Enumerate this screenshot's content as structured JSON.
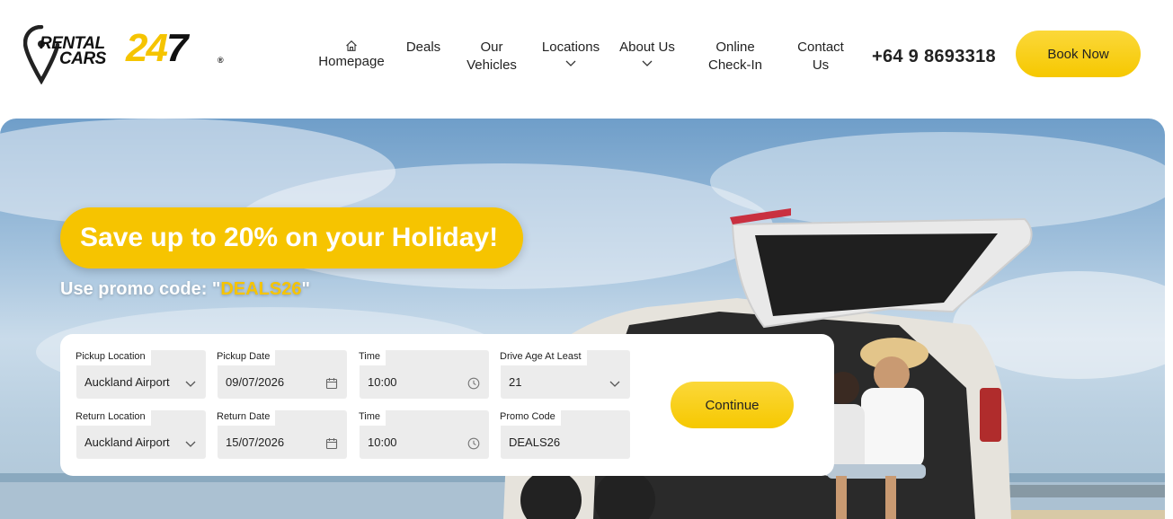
{
  "brand": {
    "logo_line1": "RENTAL",
    "logo_line2": "CARS",
    "logo_number_a": "24",
    "logo_number_b": "7",
    "logo_reg": "®"
  },
  "nav": {
    "items": [
      {
        "label_1": "Homepage",
        "label_2": "",
        "icon": "home-icon",
        "dropdown": false
      },
      {
        "label_1": "Deals",
        "label_2": "",
        "dropdown": false
      },
      {
        "label_1": "Our",
        "label_2": "Vehicles",
        "dropdown": false
      },
      {
        "label_1": "Locations",
        "label_2": "",
        "dropdown": true
      },
      {
        "label_1": "About Us",
        "label_2": "",
        "dropdown": true
      },
      {
        "label_1": "Online",
        "label_2": "Check-In",
        "dropdown": false
      },
      {
        "label_1": "Contact",
        "label_2": "Us",
        "dropdown": false
      }
    ],
    "phone": "+64 9 8693318",
    "book_label": "Book Now"
  },
  "hero": {
    "headline": "Save up to 20% on your Holiday!",
    "promo_prefix": "Use promo code: \"",
    "promo_code": "DEALS26",
    "promo_suffix": "\""
  },
  "booking": {
    "pickup_location": {
      "label": "Pickup Location",
      "value": "Auckland Airport",
      "icon": "chevron-down-icon"
    },
    "pickup_date": {
      "label": "Pickup Date",
      "value": "09/07/2026",
      "icon": "calendar-icon"
    },
    "pickup_time": {
      "label": "Time",
      "value": "10:00",
      "icon": "clock-icon"
    },
    "driver_age": {
      "label": "Drive Age At Least",
      "value": "21",
      "icon": "chevron-down-icon"
    },
    "return_location": {
      "label": "Return Location",
      "value": "Auckland Airport",
      "icon": "chevron-down-icon"
    },
    "return_date": {
      "label": "Return Date",
      "value": "15/07/2026",
      "icon": "calendar-icon"
    },
    "return_time": {
      "label": "Time",
      "value": "10:00",
      "icon": "clock-icon"
    },
    "promo": {
      "label": "Promo Code",
      "value": "DEALS26"
    },
    "continue_label": "Continue"
  },
  "colors": {
    "accent": "#f6c400",
    "text": "#222222",
    "field_bg": "#ececec"
  }
}
